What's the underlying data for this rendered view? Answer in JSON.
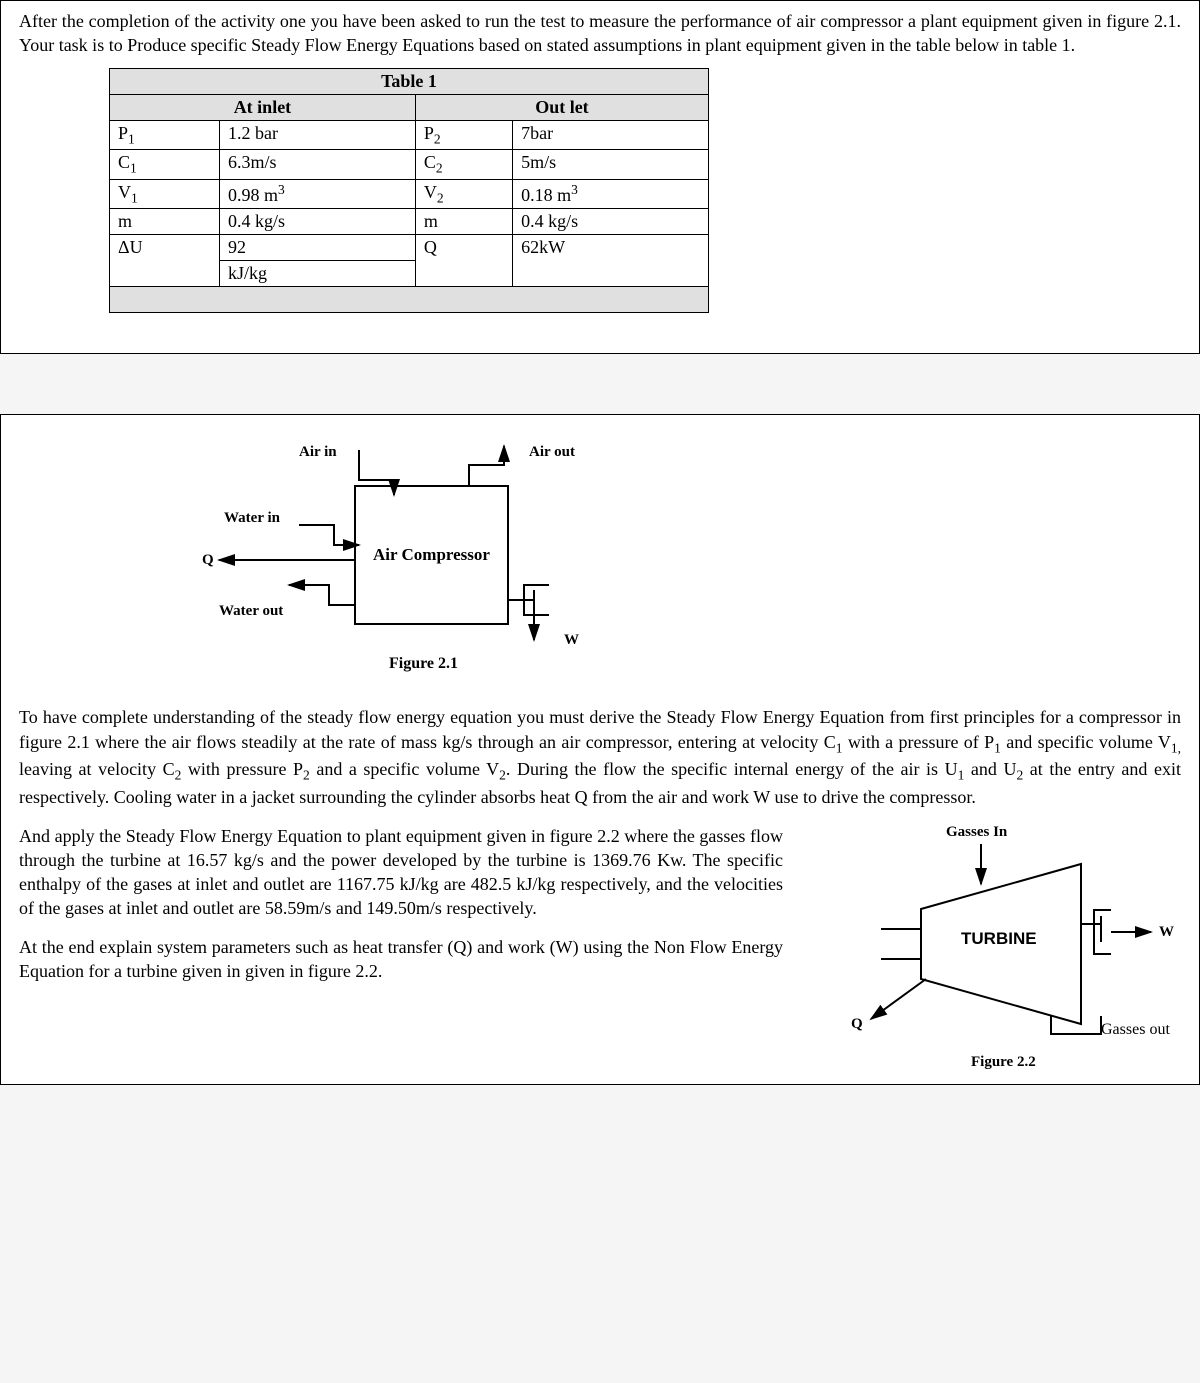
{
  "section1": {
    "intro": "After the completion of the activity one you have been asked to run the test to measure the performance of air compressor a plant equipment given in figure 2.1. Your task is to Produce specific Steady Flow Energy Equations based on stated assumptions in plant equipment given in the table below in table 1."
  },
  "table1": {
    "title": "Table 1",
    "header_inlet": "At inlet",
    "header_outlet": "Out let",
    "rows": [
      {
        "k1": "P",
        "s1": "1",
        "v1": "1.2 bar",
        "k2": "P",
        "s2": "2",
        "v2": "7bar"
      },
      {
        "k1": "C",
        "s1": "1",
        "v1": "6.3m/s",
        "k2": "C",
        "s2": "2",
        "v2": "5m/s"
      },
      {
        "k1": "V",
        "s1": "1",
        "v1": "0.98 m",
        "u1": "3",
        "k2": "V",
        "s2": "2",
        "v2": "0.18 m",
        "u2": "3"
      },
      {
        "k1": "m",
        "s1": "",
        "v1": "0.4 kg/s",
        "k2": "m",
        "s2": "",
        "v2": "0.4 kg/s"
      },
      {
        "k1": "ΔU",
        "s1": "",
        "v1": "92",
        "k2": "Q",
        "s2": "",
        "v2": "62kW"
      }
    ],
    "extra_v1": "kJ/kg"
  },
  "figure21": {
    "air_in": "Air in",
    "air_out": "Air out",
    "water_in": "Water in",
    "water_out": "Water out",
    "q": "Q",
    "w": "W",
    "box_label": "Air Compressor",
    "caption": "Figure 2.1"
  },
  "section2": {
    "para1_a": "To have complete understanding of the steady flow energy equation you must derive the Steady Flow Energy Equation from first principles for a compressor in figure 2.1 where the air flows steadily at the rate of mass kg/s through an air compressor, entering at velocity C",
    "para1_b": " with a pressure of P",
    "para1_c": " and specific volume V",
    "para1_d": " leaving at velocity C",
    "para1_e": " with pressure P",
    "para1_f": " and a specific volume V",
    "para1_g": ". During the flow the specific internal energy of the air is U",
    "para1_h": " and U",
    "para1_i": " at the entry and exit respectively. Cooling water in a jacket surrounding the cylinder absorbs heat Q from the air and work W use to drive the compressor.",
    "para2": "And apply the Steady Flow Energy Equation to plant equipment given in figure 2.2 where the gasses flow through the turbine at 16.57 kg/s and the power developed by the turbine is 1369.76 Kw. The specific enthalpy of the gases at inlet and outlet are 1167.75 kJ/kg are 482.5 kJ/kg respectively, and the velocities of the gases at inlet and outlet are 58.59m/s and 149.50m/s respectively.",
    "para3": "At the end explain system parameters such as heat transfer (Q) and work (W) using the Non Flow Energy Equation for a turbine given in given in figure 2.2."
  },
  "figure22": {
    "gasses_in": "Gasses In",
    "gasses_out": "Gasses out",
    "turbine": "TURBINE",
    "w": "W",
    "q": "Q",
    "caption": "Figure 2.2"
  }
}
